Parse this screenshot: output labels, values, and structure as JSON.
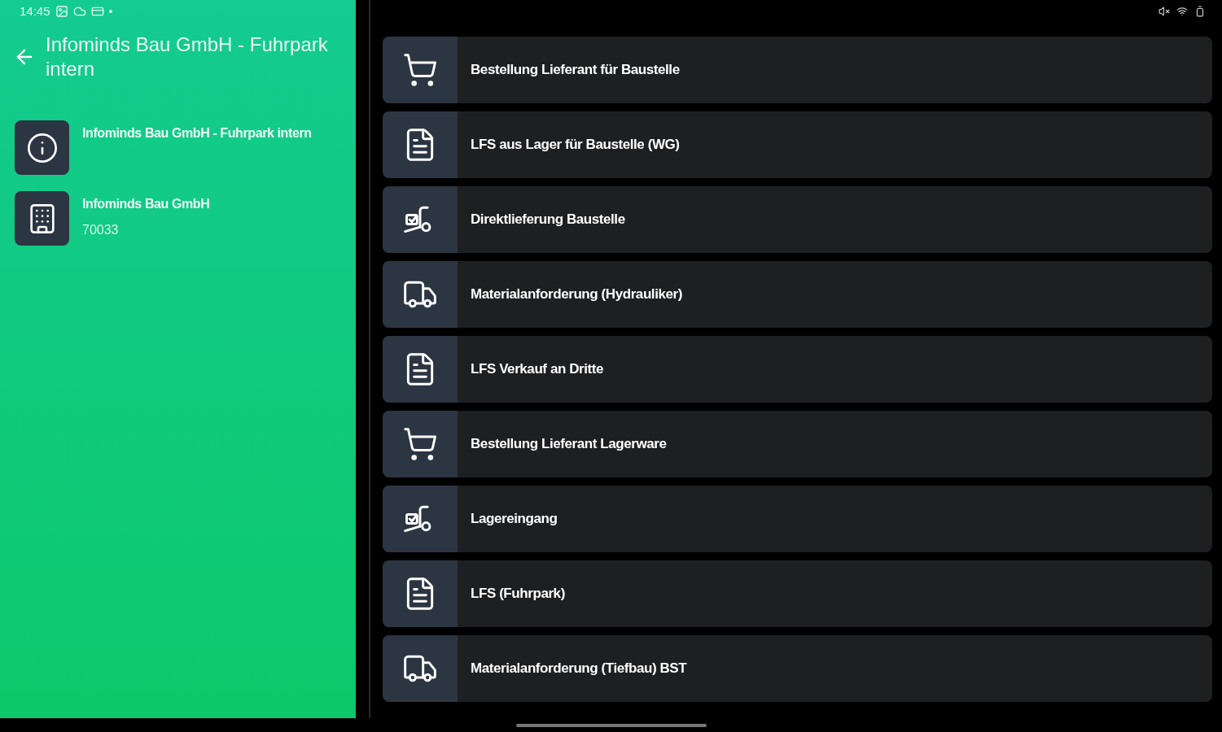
{
  "status_bar": {
    "time": "14:45"
  },
  "header": {
    "title": "Infominds Bau GmbH - Fuhrpark intern"
  },
  "info_items": [
    {
      "kind": "info",
      "title": "Infominds Bau GmbH - Fuhrpark intern"
    },
    {
      "kind": "company",
      "title": "Infominds Bau GmbH",
      "subtitle": "70033"
    }
  ],
  "actions": [
    {
      "kind": "cart",
      "label": "Bestellung Lieferant für Baustelle"
    },
    {
      "kind": "document",
      "label": "LFS aus Lager für Baustelle (WG)"
    },
    {
      "kind": "dolly",
      "label": "Direktlieferung Baustelle"
    },
    {
      "kind": "truck",
      "label": "Materialanforderung (Hydrauliker)"
    },
    {
      "kind": "document",
      "label": "LFS Verkauf an Dritte"
    },
    {
      "kind": "cart",
      "label": "Bestellung Lieferant Lagerware"
    },
    {
      "kind": "dolly",
      "label": "Lagereingang"
    },
    {
      "kind": "document",
      "label": "LFS (Fuhrpark)"
    },
    {
      "kind": "truck",
      "label": "Materialanforderung (Tiefbau) BST"
    }
  ]
}
